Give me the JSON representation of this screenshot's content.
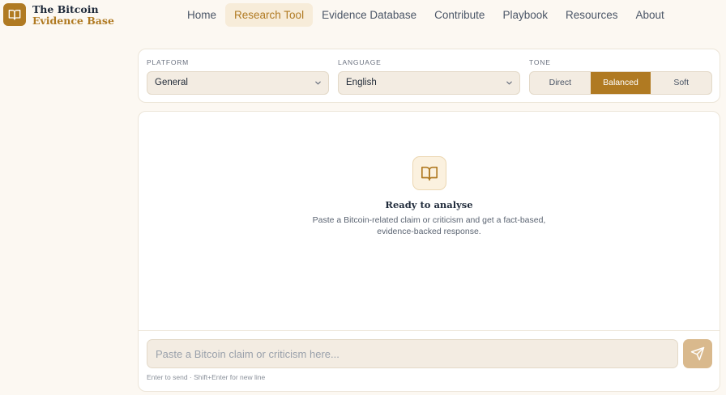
{
  "brand": {
    "line1": "The Bitcoin",
    "line2": "Evidence Base",
    "icon": "book-open-icon",
    "color": "#b07a22"
  },
  "nav": {
    "items": [
      {
        "label": "Home",
        "active": false
      },
      {
        "label": "Research Tool",
        "active": true
      },
      {
        "label": "Evidence Database",
        "active": false
      },
      {
        "label": "Contribute",
        "active": false
      },
      {
        "label": "Playbook",
        "active": false
      },
      {
        "label": "Resources",
        "active": false
      },
      {
        "label": "About",
        "active": false
      }
    ]
  },
  "controls": {
    "platform": {
      "label": "PLATFORM",
      "value": "General"
    },
    "language": {
      "label": "LANGUAGE",
      "value": "English"
    },
    "tone": {
      "label": "TONE",
      "options": [
        "Direct",
        "Balanced",
        "Soft"
      ],
      "selected": "Balanced"
    }
  },
  "main": {
    "empty_icon": "book-open-icon",
    "title": "Ready to analyse",
    "description": "Paste a Bitcoin-related claim or criticism and get a fact-based, evidence-backed response."
  },
  "composer": {
    "placeholder": "Paste a Bitcoin claim or criticism here...",
    "value": "",
    "send_icon": "send-icon",
    "hint": "Enter to send · Shift+Enter for new line"
  }
}
